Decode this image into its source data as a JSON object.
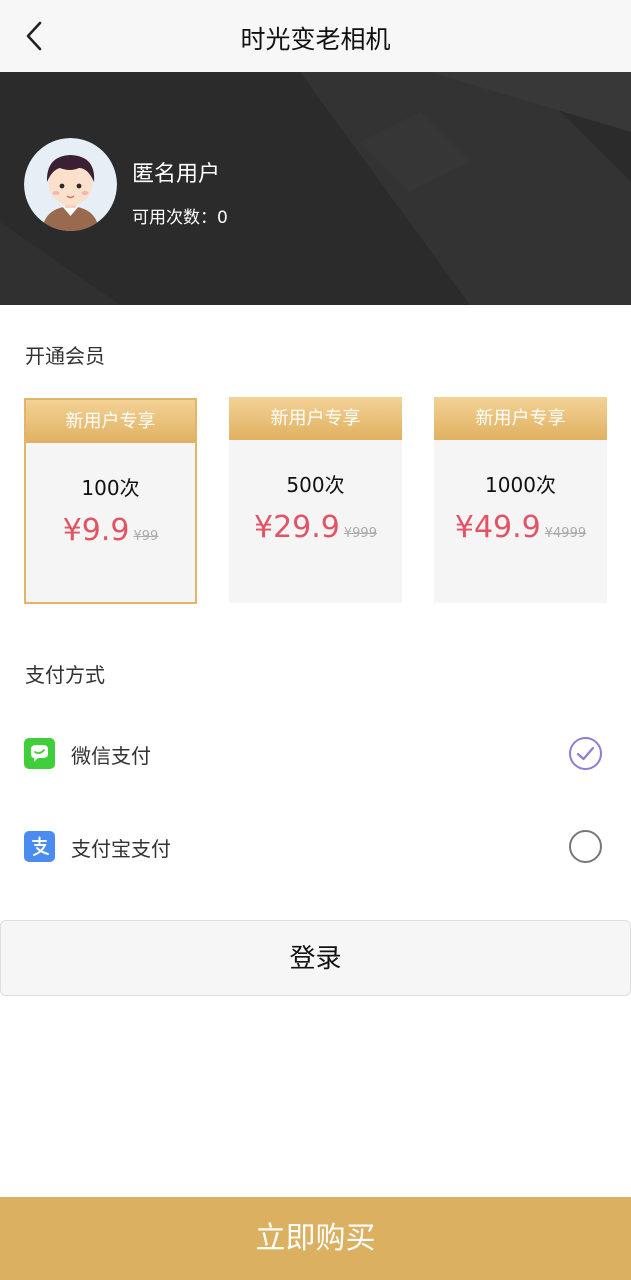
{
  "header": {
    "title": "时光变老相机",
    "back_icon": "chevron-left-icon"
  },
  "user": {
    "name": "匿名用户",
    "count_text": "可用次数：0"
  },
  "membership": {
    "section_title": "开通会员",
    "packages": [
      {
        "ribbon": "新用户专享",
        "times": "100次",
        "price": "¥9.9",
        "original_price": "¥99",
        "selected": true
      },
      {
        "ribbon": "新用户专享",
        "times": "500次",
        "price": "¥29.9",
        "original_price": "¥999",
        "selected": false
      },
      {
        "ribbon": "新用户专享",
        "times": "1000次",
        "price": "¥49.9",
        "original_price": "¥4999",
        "selected": false
      }
    ]
  },
  "payment": {
    "section_title": "支付方式",
    "methods": [
      {
        "label": "微信支付",
        "icon": "wechat-pay-icon",
        "checked": true
      },
      {
        "label": "支付宝支付",
        "icon": "alipay-icon",
        "checked": false
      }
    ]
  },
  "buttons": {
    "login": "登录",
    "buy": "立即购买"
  },
  "colors": {
    "accent_gold": "#dcb061",
    "price_red": "#e25464",
    "check_purple": "#8a7fd6",
    "hero_bg": "#2b2b2b"
  }
}
